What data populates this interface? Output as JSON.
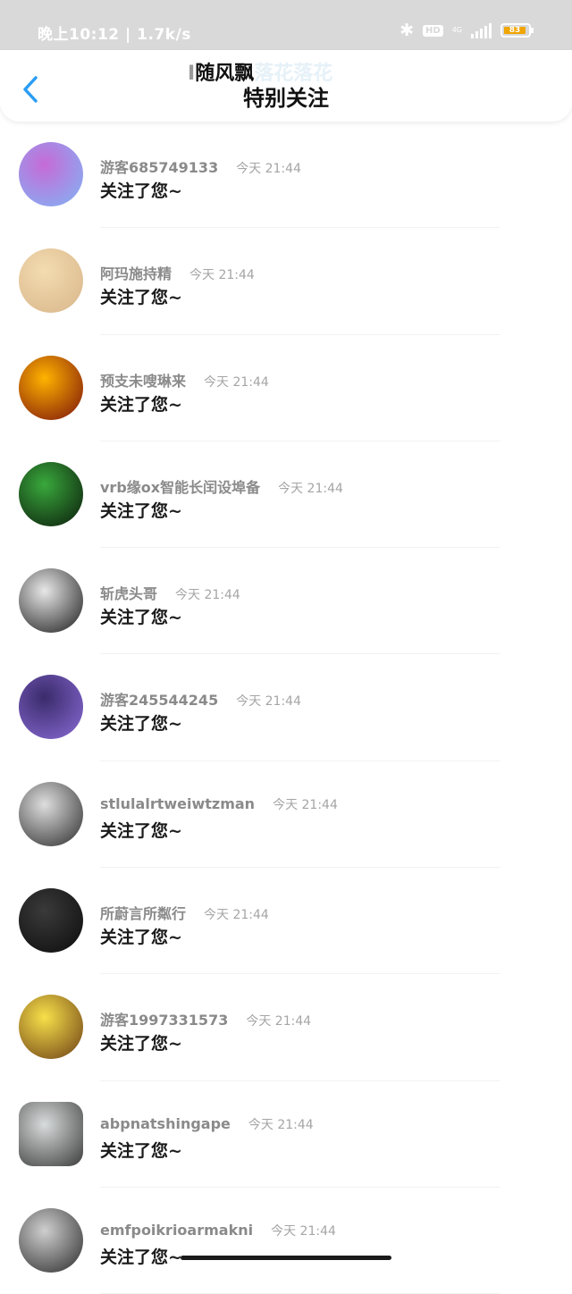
{
  "status_bar": {
    "time_speed": "晚上10:12 | 1.7k/s",
    "hd": "HD",
    "network": "4G",
    "battery": "83"
  },
  "header": {
    "marquee_main": "随风飘",
    "marquee_fade": "落花落花",
    "marquee_prefix": "I",
    "title": "特别关注"
  },
  "notifications": [
    {
      "name": "游客685749133",
      "time": "今天 21:44",
      "message": "关注了您~",
      "avatar_colors": [
        "#c66ad7",
        "#7fb6f5"
      ]
    },
    {
      "name": "阿玛施持精",
      "time": "今天 21:44",
      "message": "关注了您~",
      "avatar_colors": [
        "#f3dcb0",
        "#d8b58a"
      ]
    },
    {
      "name": "预支未嗖琳来",
      "time": "今天 21:44",
      "message": "关注了您~",
      "avatar_colors": [
        "#ffb400",
        "#7a0f0a"
      ]
    },
    {
      "name": "vrb缘ox智能长闰设埠备",
      "time": "今天 21:44",
      "message": "关注了您~",
      "avatar_colors": [
        "#39a83c",
        "#0b1a0b"
      ]
    },
    {
      "name": "斩虎头哥",
      "time": "今天 21:44",
      "message": "关注了您~",
      "avatar_colors": [
        "#e8e8e8",
        "#1a1a1a"
      ]
    },
    {
      "name": "游客245544245",
      "time": "今天 21:44",
      "message": "关注了您~",
      "avatar_colors": [
        "#3a2b6b",
        "#8a6bd6"
      ]
    },
    {
      "name": "stlulalrtweiwtzman",
      "time": "今天 21:44",
      "message": "关注了您~",
      "avatar_colors": [
        "#dedede",
        "#2b2b2b"
      ]
    },
    {
      "name": "所蔚言所粼行",
      "time": "今天 21:44",
      "message": "关注了您~",
      "avatar_colors": [
        "#3a3a3a",
        "#0c0c0c"
      ]
    },
    {
      "name": "游客1997331573",
      "time": "今天 21:44",
      "message": "关注了您~",
      "avatar_colors": [
        "#f7e04a",
        "#6b3d14"
      ]
    },
    {
      "name": "abpnatshingape",
      "time": "今天 21:44",
      "message": "关注了您~",
      "avatar_colors": [
        "#d9dcdc",
        "#3c3c3c"
      ]
    },
    {
      "name": "emfpoikrioarmakni",
      "time": "今天 21:44",
      "message": "关注了您~",
      "avatar_colors": [
        "#cfcfcf",
        "#2a2a2a"
      ]
    }
  ]
}
